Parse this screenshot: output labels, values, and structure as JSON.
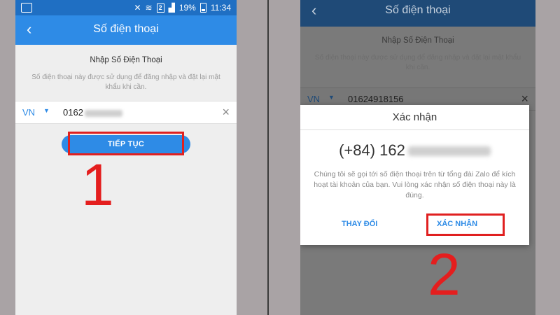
{
  "left": {
    "status": {
      "battery_pct": "19%",
      "time": "11:34",
      "sim": "2"
    },
    "appbar": {
      "title": "Số điện thoại"
    },
    "title": "Nhập Số Điện Thoại",
    "description": "Số điện thoại này được sử dụng để đăng nhập và đặt lại mật khẩu khi cần.",
    "country_code": "VN",
    "phone_visible": "0162",
    "continue_label": "TIẾP TỤC",
    "step": "1"
  },
  "right": {
    "appbar": {
      "title": "Số điện thoại"
    },
    "title": "Nhập Số Điện Thoại",
    "description": "Số điện thoại này được sử dụng để đăng nhập và đặt lại mật khẩu khi cần.",
    "country_code": "VN",
    "phone_value": "01624918156",
    "dialog": {
      "title": "Xác nhận",
      "number_visible": "(+84) 162",
      "message": "Chúng tôi sẽ gọi tới số điện thoại trên từ tổng đài Zalo để kích hoạt tài khoản của bạn. Vui lòng xác nhận số điện thoại này là đúng.",
      "change_label": "THAY ĐỔI",
      "confirm_label": "XÁC NHẬN"
    },
    "step": "2"
  },
  "colors": {
    "appbar": "#2e8be6",
    "statusbar": "#1f6fc3",
    "highlight": "#e02020",
    "step_number": "#e41e1e"
  }
}
